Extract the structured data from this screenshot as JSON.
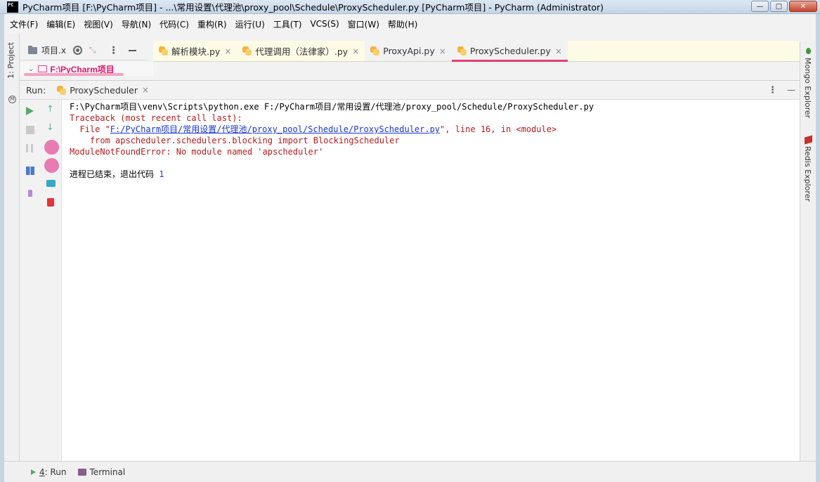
{
  "window": {
    "title": "PyCharm项目 [F:\\PyCharm项目] - ...\\常用设置\\代理池\\proxy_pool\\Schedule\\ProxyScheduler.py [PyCharm项目] - PyCharm (Administrator)",
    "app_icon_text": "PC",
    "minimize": "—",
    "maximize": "□",
    "close": "✕"
  },
  "menu": [
    "文件(F)",
    "编辑(E)",
    "视图(V)",
    "导航(N)",
    "代码(C)",
    "重构(R)",
    "运行(U)",
    "工具(T)",
    "VCS(S)",
    "窗口(W)",
    "帮助(H)"
  ],
  "left_strip": {
    "project_label": "1: Project",
    "mongo_badge": "M"
  },
  "right_strip": {
    "mongo_label": "Mongo Explorer",
    "redis_label": "Redis Explorer"
  },
  "project_panel": {
    "title": "项目.x",
    "tree_root": "F:\\PyCharm项目",
    "more_icon": "⋮"
  },
  "editor_tabs": [
    {
      "label": "解析模块.py",
      "close": "×"
    },
    {
      "label": "代理调用（法律家）.py",
      "close": "×"
    },
    {
      "label": "ProxyApi.py",
      "close": "×"
    },
    {
      "label": "ProxyScheduler.py",
      "close": "×"
    }
  ],
  "run_panel": {
    "label": "Run:",
    "tab": "ProxyScheduler",
    "tab_close": "×",
    "more": "⋮",
    "hide": "—"
  },
  "console": {
    "command": "F:\\PyCharm项目\\venv\\Scripts\\python.exe F:/PyCharm项目/常用设置/代理池/proxy_pool/Schedule/ProxyScheduler.py",
    "traceback": "Traceback (most recent call last):",
    "file_prefix": "  File \"",
    "file_link": "F:/PyCharm项目/常用设置/代理池/proxy_pool/Schedule/ProxyScheduler.py",
    "file_suffix": "\", line 16, in <module>",
    "code_line": "    from apscheduler.schedulers.blocking import BlockingScheduler",
    "error": "ModuleNotFoundError: No module named 'apscheduler'",
    "exit_text": "进程已结束，退出代码 ",
    "exit_code": "1"
  },
  "bottom_tabs": {
    "run_num": "4",
    "run_rest": ": Run",
    "terminal": "Terminal"
  },
  "colors": {
    "accent": "#e53f73",
    "error": "#b81b1b",
    "link": "#1a37d9",
    "run_green": "#59a869"
  }
}
